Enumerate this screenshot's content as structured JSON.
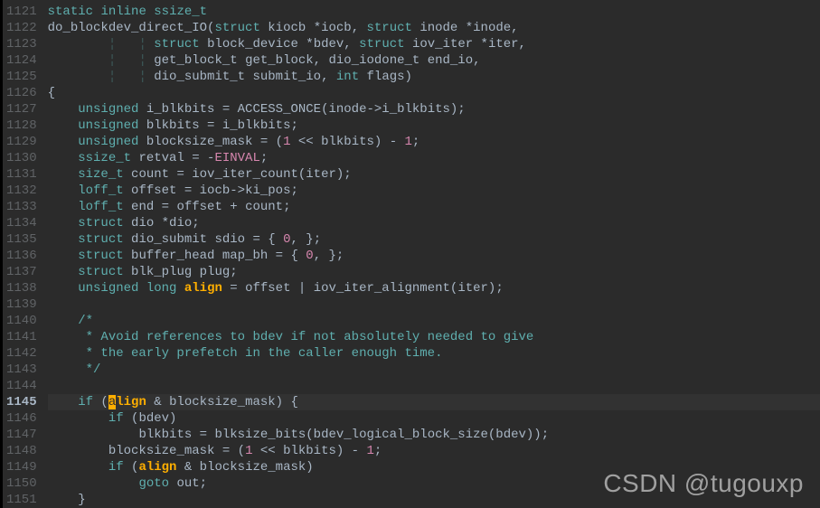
{
  "editor": {
    "current_line_index": 24,
    "cursor_col": 13,
    "lines": [
      {
        "num": "1121",
        "tokens": [
          [
            "kw",
            "static"
          ],
          [
            "",
            ""
          ],
          [
            "kw",
            "inline"
          ],
          [
            "",
            ""
          ],
          [
            "type",
            "ssize_t"
          ]
        ]
      },
      {
        "num": "1122",
        "tokens": [
          [
            "id",
            "do_blockdev_direct_IO("
          ],
          [
            "kw",
            "struct"
          ],
          [
            "",
            ""
          ],
          [
            "id",
            "kiocb *iocb, "
          ],
          [
            "kw",
            "struct"
          ],
          [
            "",
            ""
          ],
          [
            "id",
            "inode *inode,"
          ]
        ]
      },
      {
        "num": "1123",
        "tokens": [
          [
            "",
            "        "
          ],
          [
            "guide",
            "¦   "
          ],
          [
            "guide",
            "¦ "
          ],
          [
            "kw",
            "struct"
          ],
          [
            "",
            ""
          ],
          [
            "id",
            "block_device *bdev, "
          ],
          [
            "kw",
            "struct"
          ],
          [
            "",
            ""
          ],
          [
            "id",
            "iov_iter *iter,"
          ]
        ]
      },
      {
        "num": "1124",
        "tokens": [
          [
            "",
            "        "
          ],
          [
            "guide",
            "¦   "
          ],
          [
            "guide",
            "¦ "
          ],
          [
            "id",
            "get_block_t get_block, dio_iodone_t end_io,"
          ]
        ]
      },
      {
        "num": "1125",
        "tokens": [
          [
            "",
            "        "
          ],
          [
            "guide",
            "¦   "
          ],
          [
            "guide",
            "¦ "
          ],
          [
            "id",
            "dio_submit_t submit_io, "
          ],
          [
            "kw",
            "int"
          ],
          [
            "",
            ""
          ],
          [
            "id",
            "flags)"
          ]
        ]
      },
      {
        "num": "1126",
        "tokens": [
          [
            "id",
            "{"
          ]
        ]
      },
      {
        "num": "1127",
        "tokens": [
          [
            "",
            "    "
          ],
          [
            "kw",
            "unsigned"
          ],
          [
            "",
            ""
          ],
          [
            "id",
            "i_blkbits = ACCESS_ONCE(inode->i_blkbits);"
          ]
        ]
      },
      {
        "num": "1128",
        "tokens": [
          [
            "",
            "    "
          ],
          [
            "kw",
            "unsigned"
          ],
          [
            "",
            ""
          ],
          [
            "id",
            "blkbits = i_blkbits;"
          ]
        ]
      },
      {
        "num": "1129",
        "tokens": [
          [
            "",
            "    "
          ],
          [
            "kw",
            "unsigned"
          ],
          [
            "",
            ""
          ],
          [
            "id",
            "blocksize_mask = ("
          ],
          [
            "num",
            "1"
          ],
          [
            "id",
            " << blkbits) - "
          ],
          [
            "num",
            "1"
          ],
          [
            "id",
            ";"
          ]
        ]
      },
      {
        "num": "1130",
        "tokens": [
          [
            "",
            "    "
          ],
          [
            "type",
            "ssize_t"
          ],
          [
            "",
            ""
          ],
          [
            "id",
            "retval = -"
          ],
          [
            "const",
            "EINVAL"
          ],
          [
            "id",
            ";"
          ]
        ]
      },
      {
        "num": "1131",
        "tokens": [
          [
            "",
            "    "
          ],
          [
            "type",
            "size_t"
          ],
          [
            "",
            ""
          ],
          [
            "id",
            "count = iov_iter_count(iter);"
          ]
        ]
      },
      {
        "num": "1132",
        "tokens": [
          [
            "",
            "    "
          ],
          [
            "type",
            "loff_t"
          ],
          [
            "",
            ""
          ],
          [
            "id",
            "offset = iocb->ki_pos;"
          ]
        ]
      },
      {
        "num": "1133",
        "tokens": [
          [
            "",
            "    "
          ],
          [
            "type",
            "loff_t"
          ],
          [
            "",
            ""
          ],
          [
            "id",
            "end = offset + count;"
          ]
        ]
      },
      {
        "num": "1134",
        "tokens": [
          [
            "",
            "    "
          ],
          [
            "kw",
            "struct"
          ],
          [
            "",
            ""
          ],
          [
            "id",
            "dio *dio;"
          ]
        ]
      },
      {
        "num": "1135",
        "tokens": [
          [
            "",
            "    "
          ],
          [
            "kw",
            "struct"
          ],
          [
            "",
            ""
          ],
          [
            "id",
            "dio_submit sdio = { "
          ],
          [
            "num",
            "0"
          ],
          [
            "id",
            ", };"
          ]
        ]
      },
      {
        "num": "1136",
        "tokens": [
          [
            "",
            "    "
          ],
          [
            "kw",
            "struct"
          ],
          [
            "",
            ""
          ],
          [
            "id",
            "buffer_head map_bh = { "
          ],
          [
            "num",
            "0"
          ],
          [
            "id",
            ", };"
          ]
        ]
      },
      {
        "num": "1137",
        "tokens": [
          [
            "",
            "    "
          ],
          [
            "kw",
            "struct"
          ],
          [
            "",
            ""
          ],
          [
            "id",
            "blk_plug plug;"
          ]
        ]
      },
      {
        "num": "1138",
        "tokens": [
          [
            "",
            "    "
          ],
          [
            "kw",
            "unsigned"
          ],
          [
            "",
            ""
          ],
          [
            "kw",
            "long"
          ],
          [
            "",
            ""
          ],
          [
            "hl",
            "align"
          ],
          [
            "id",
            " = offset | iov_iter_alignment(iter);"
          ]
        ]
      },
      {
        "num": "1139",
        "tokens": [
          [
            "",
            ""
          ]
        ]
      },
      {
        "num": "1140",
        "tokens": [
          [
            "",
            "    "
          ],
          [
            "comment",
            "/*"
          ]
        ]
      },
      {
        "num": "1141",
        "tokens": [
          [
            "",
            "    "
          ],
          [
            "comment",
            " * Avoid references to bdev if not absolutely needed to give"
          ]
        ]
      },
      {
        "num": "1142",
        "tokens": [
          [
            "",
            "    "
          ],
          [
            "comment",
            " * the early prefetch in the caller enough time."
          ]
        ]
      },
      {
        "num": "1143",
        "tokens": [
          [
            "",
            "    "
          ],
          [
            "comment",
            " */"
          ]
        ]
      },
      {
        "num": "1144",
        "tokens": [
          [
            "",
            ""
          ]
        ]
      },
      {
        "num": "1145",
        "tokens": [
          [
            "",
            "    "
          ],
          [
            "kw",
            "if"
          ],
          [
            "id",
            " ("
          ],
          [
            "cursor-bg",
            "a"
          ],
          [
            "hl",
            "lign"
          ],
          [
            "id",
            " & blocksize_mask) {"
          ]
        ]
      },
      {
        "num": "1146",
        "tokens": [
          [
            "",
            "        "
          ],
          [
            "kw",
            "if"
          ],
          [
            "id",
            " (bdev)"
          ]
        ]
      },
      {
        "num": "1147",
        "tokens": [
          [
            "",
            "            "
          ],
          [
            "id",
            "blkbits = blksize_bits(bdev_logical_block_size(bdev));"
          ]
        ]
      },
      {
        "num": "1148",
        "tokens": [
          [
            "",
            "        "
          ],
          [
            "id",
            "blocksize_mask = ("
          ],
          [
            "num",
            "1"
          ],
          [
            "id",
            " << blkbits) - "
          ],
          [
            "num",
            "1"
          ],
          [
            "id",
            ";"
          ]
        ]
      },
      {
        "num": "1149",
        "tokens": [
          [
            "",
            "        "
          ],
          [
            "kw",
            "if"
          ],
          [
            "id",
            " ("
          ],
          [
            "hl",
            "align"
          ],
          [
            "id",
            " & blocksize_mask)"
          ]
        ]
      },
      {
        "num": "1150",
        "tokens": [
          [
            "",
            "            "
          ],
          [
            "kw",
            "goto"
          ],
          [
            "id",
            " out;"
          ]
        ]
      },
      {
        "num": "1151",
        "tokens": [
          [
            "",
            "    "
          ],
          [
            "id",
            "}"
          ]
        ]
      }
    ],
    "guide_col": 8
  },
  "watermark": "CSDN @tugouxp"
}
